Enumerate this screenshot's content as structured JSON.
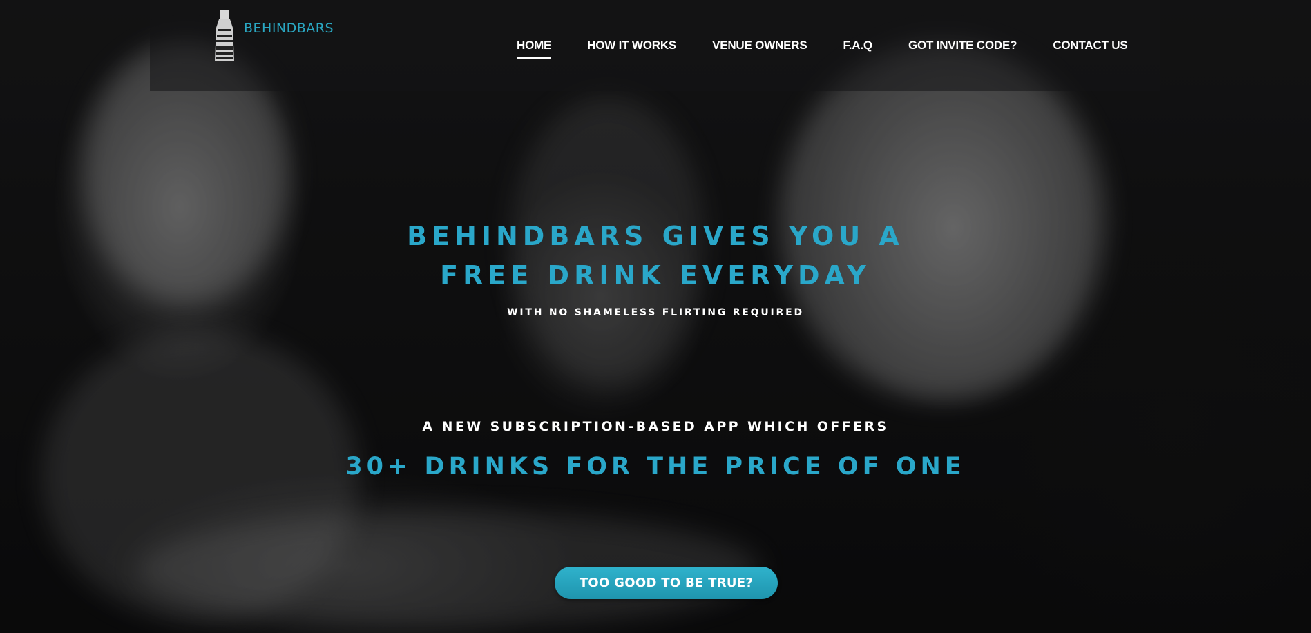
{
  "brand": {
    "name": "BEHINDBARS",
    "logo_icon": "bottle-logo-icon",
    "logo_text_lines": [
      "DRINK",
      "EAT",
      "DANCE",
      "CHUG",
      "music",
      "SHOT"
    ]
  },
  "nav": {
    "items": [
      {
        "label": "HOME",
        "active": true
      },
      {
        "label": "HOW IT WORKS",
        "active": false
      },
      {
        "label": "VENUE OWNERS",
        "active": false
      },
      {
        "label": "F.A.Q",
        "active": false
      },
      {
        "label": "GOT INVITE CODE?",
        "active": false
      },
      {
        "label": "CONTACT US",
        "active": false
      }
    ]
  },
  "hero": {
    "headline_line1": "BEHINDBARS GIVES YOU A",
    "headline_line2": "FREE DRINK EVERYDAY",
    "tagline": "WITH NO SHAMELESS FLIRTING REQUIRED",
    "subhead": "A NEW SUBSCRIPTION-BASED APP WHICH OFFERS",
    "offer": "30+ DRINKS FOR THE PRICE OF ONE",
    "cta_label": "TOO GOOD TO BE TRUE?"
  },
  "colors": {
    "accent": "#2aa7c9",
    "cta": "#2fb2cc",
    "text": "#ffffff",
    "background": "#151516"
  }
}
